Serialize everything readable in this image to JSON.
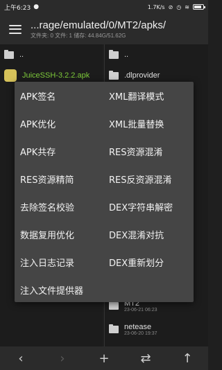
{
  "status": {
    "time": "上午6:23",
    "speed": "1.7K/s",
    "battery_icon": "battery-icon"
  },
  "toolbar": {
    "path": "...rage/emulated/0/MT2/apks/",
    "info": "文件夹: 0  文件: 1  储存: 44.84G/51.62G"
  },
  "left_pane": {
    "up": "..",
    "files": [
      {
        "name": "JuiceSSH-3.2.2.apk"
      }
    ]
  },
  "right_pane": {
    "up": "..",
    "items": [
      {
        "name": ".dlprovider",
        "meta": ""
      },
      {
        "name": "MT2",
        "meta": "23-06-21 06:23"
      },
      {
        "name": "netease",
        "meta": "23-06-20 19:37"
      }
    ]
  },
  "menu": {
    "left": [
      "APK签名",
      "APK优化",
      "APK共存",
      "RES资源精简",
      "去除签名校验",
      "数据复用优化",
      "注入日志记录",
      "注入文件提供器"
    ],
    "right": [
      "XML翻译模式",
      "XML批量替换",
      "RES资源混淆",
      "RES反资源混淆",
      "DEX字符串解密",
      "DEX混淆对抗",
      "DEX重新划分"
    ]
  },
  "bottombar": {
    "back": "‹",
    "forward": "›",
    "add": "+",
    "swap": "⇄",
    "up": "↑"
  }
}
